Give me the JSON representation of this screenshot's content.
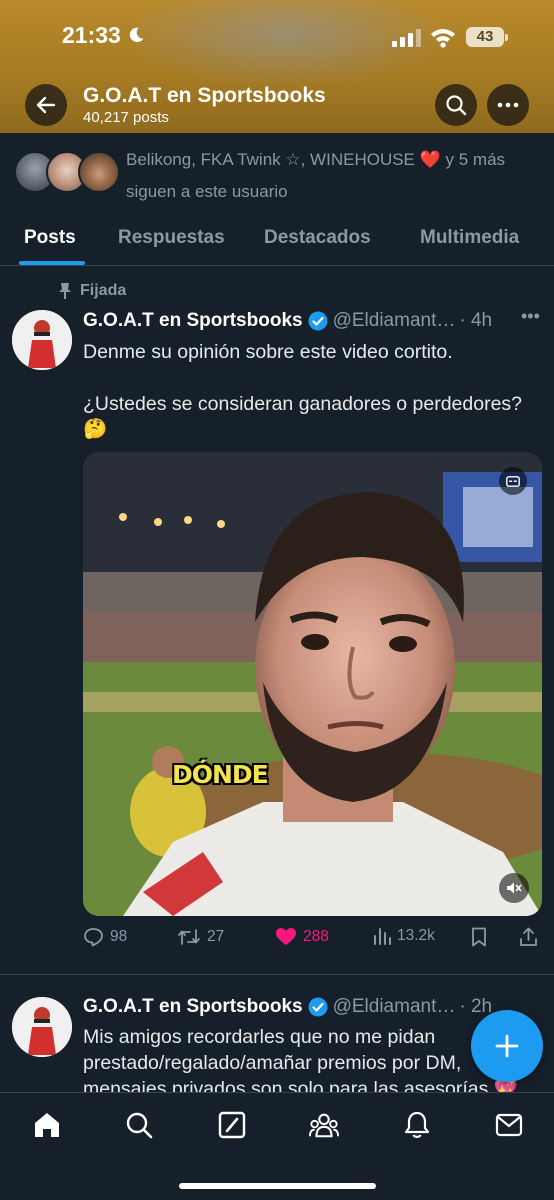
{
  "status_bar": {
    "time": "21:33",
    "battery": "43"
  },
  "header": {
    "title": "G.O.A.T en Sportsbooks",
    "post_count": "40,217 posts"
  },
  "followers": {
    "text": "Belikong, FKA Twink ☆, WINEHOUSE ❤️ y 5 más siguen a este usuario"
  },
  "tabs": [
    {
      "label": "Posts"
    },
    {
      "label": "Respuestas"
    },
    {
      "label": "Destacados"
    },
    {
      "label": "Multimedia"
    }
  ],
  "pinned_label": "Fijada",
  "tweets": [
    {
      "name": "G.O.A.T en Sportsbooks",
      "handle": "@Eldiamant…",
      "time": "· 4h",
      "line1": "Denme su opinión sobre este video cortito.",
      "line2": "¿Ustedes se consideran ganadores o perdedores?",
      "emoji": "🤔",
      "video_caption": "DÓNDE",
      "replies": "98",
      "reposts": "27",
      "likes": "288",
      "views": "13.2k"
    },
    {
      "name": "G.O.A.T en Sportsbooks",
      "handle": "@Eldiamant…",
      "time": "· 2h",
      "text": "Mis amigos recordarles que no me pidan prestado/regalado/amañar premios por DM, mensajes privados son solo para las asesorías 💖"
    }
  ],
  "colors": {
    "accent": "#1d9bf0",
    "like": "#f91880",
    "background": "#15202b",
    "header": "#a57a22"
  }
}
